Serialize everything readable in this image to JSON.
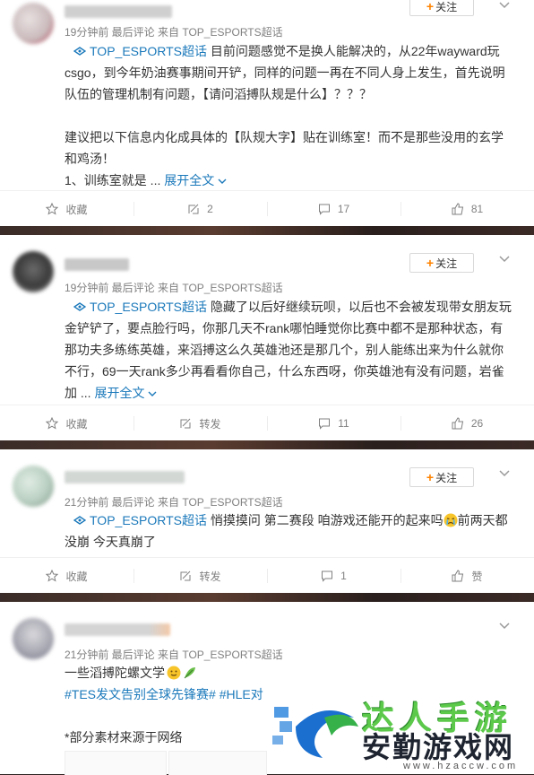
{
  "colors": {
    "topic": "#1b79bb",
    "follow_plus": "#ff8200",
    "meta": "#808080"
  },
  "follow_label": "关注",
  "posts": [
    {
      "meta": "19分钟前  最后评论  来自 TOP_ESPORTS超话",
      "topic": "TOP_ESPORTS超话",
      "text_line1_rest": " 目前问题感觉不是换人能解决的，从22年wayward玩",
      "text_rest": "csgo，到今年奶油赛事期间开铲，同样的问题一再在不同人身上发生，首先说明队伍的管理机制有问题，【请问滔搏队规是什么】？？？",
      "text_p2": "建议把以下信息内化成具体的【队规大字】贴在训练室！而不是那些没用的玄学和鸡汤！",
      "text_p3": "1、训练室就是 ...",
      "expand": "展开全文",
      "actions": [
        "收藏",
        "2",
        "17",
        "81"
      ]
    },
    {
      "meta": "19分钟前  最后评论  来自 TOP_ESPORTS超话",
      "topic": "TOP_ESPORTS超话",
      "text_line1_rest": " 隐藏了以后好继续玩呗，以后也不会被发现带女朋友玩",
      "text_rest": "金铲铲了，要点脸行吗，你那几天不rank哪怕睡觉你比赛中都不是那种状态，有那功夫多练练英雄，来滔搏这么久英雄池还是那几个，别人能练出来为什么就你不行，69一天rank多少再看看你自己，什么东西呀，你英雄池有没有问题，岩雀加 ...",
      "expand": "展开全文",
      "actions": [
        "收藏",
        "转发",
        "11",
        "26"
      ]
    },
    {
      "meta": "21分钟前  最后评论  来自 TOP_ESPORTS超话",
      "topic": "TOP_ESPORTS超话",
      "text_line1_rest": " 悄摸摸问 第二赛段 咱游戏还能开的起来吗",
      "text_after_emoji": "前两天都",
      "text_rest": "没崩 今天真崩了",
      "actions": [
        "收藏",
        "转发",
        "1",
        "赞"
      ]
    },
    {
      "meta": "21分钟前  最后评论  来自 TOP_ESPORTS超话",
      "text_line1": "一些滔搏陀螺文学",
      "hashtags": "#TES发文告别全球先锋赛# #HLE对",
      "footnote": "*部分素材来源于网络"
    }
  ],
  "watermark": {
    "logo": "达人手游",
    "name": "安勤游戏网",
    "url": "www.hzaccw.com"
  }
}
